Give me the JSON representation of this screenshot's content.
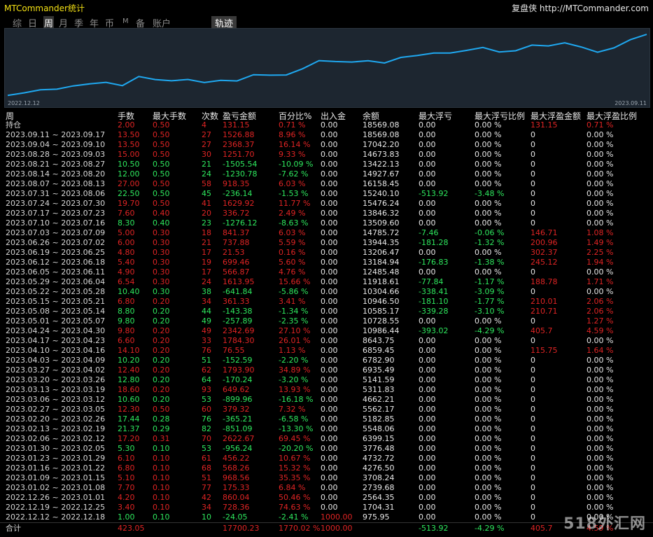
{
  "header": {
    "app_title": "MTCommander统计",
    "brand_text": "复盘侠 http://MTCommander.com"
  },
  "tabs": [
    {
      "label": "综",
      "active": false,
      "small": false
    },
    {
      "label": "日",
      "active": false,
      "small": false
    },
    {
      "label": "周",
      "active": true,
      "small": false
    },
    {
      "label": "月",
      "active": false,
      "small": false
    },
    {
      "label": "季",
      "active": false,
      "small": false
    },
    {
      "label": "年",
      "active": false,
      "small": false
    },
    {
      "label": "币",
      "active": false,
      "small": false
    },
    {
      "label": "M",
      "active": false,
      "small": true
    },
    {
      "label": "备",
      "active": false,
      "small": false
    },
    {
      "label": "账户",
      "active": false,
      "small": false
    }
  ],
  "track_tab": "轨迹",
  "chart_data": {
    "type": "line",
    "x_start": "2022.12.12",
    "x_end": "2023.09.11",
    "series_color": "#1fa8f0",
    "values": [
      975.95,
      1704.31,
      2564.35,
      2739.68,
      3708.24,
      4276.5,
      4732.72,
      3776.48,
      6399.15,
      5548.06,
      5182.85,
      5562.17,
      4662.21,
      5311.83,
      5141.59,
      6935.49,
      6782.9,
      6859.45,
      8643.75,
      10986.44,
      10728.55,
      10585.17,
      10946.5,
      10304.66,
      11918.61,
      12485.48,
      13184.94,
      13206.47,
      13944.35,
      14785.72,
      13509.6,
      13846.32,
      15476.24,
      15240.1,
      16158.45,
      14927.67,
      13422.13,
      14673.83,
      17042.2,
      18569.08
    ]
  },
  "columns": [
    "周",
    "手数",
    "最大手数",
    "次数",
    "盈亏金额",
    "百分比%",
    "出入金",
    "余额",
    "最大浮亏",
    "最大浮亏比例",
    "最大浮盈金额",
    "最大浮盈比例"
  ],
  "rows": [
    {
      "label": "持仓",
      "lots": "2.00",
      "maxlots": "0.50",
      "count": "4",
      "pnl": "131.15",
      "pct": "0.71 %",
      "io": "0.00",
      "balance": "18569.08",
      "maxdd": "0.00",
      "ddpct": "0.00 %",
      "maxfp": "131.15",
      "fppct": "0.71 %",
      "sign": "red",
      "fpcolor": "red"
    },
    {
      "label": "2023.09.11 ~ 2023.09.17",
      "lots": "13.50",
      "maxlots": "0.50",
      "count": "27",
      "pnl": "1526.88",
      "pct": "8.96 %",
      "io": "0.00",
      "balance": "18569.08",
      "maxdd": "0.00",
      "ddpct": "0.00 %",
      "maxfp": "0",
      "fppct": "0.00 %",
      "sign": "red",
      "fpcolor": "white"
    },
    {
      "label": "2023.09.04 ~ 2023.09.10",
      "lots": "13.50",
      "maxlots": "0.50",
      "count": "27",
      "pnl": "2368.37",
      "pct": "16.14 %",
      "io": "0.00",
      "balance": "17042.20",
      "maxdd": "0.00",
      "ddpct": "0.00 %",
      "maxfp": "0",
      "fppct": "0.00 %",
      "sign": "red",
      "fpcolor": "white"
    },
    {
      "label": "2023.08.28 ~ 2023.09.03",
      "lots": "15.00",
      "maxlots": "0.50",
      "count": "30",
      "pnl": "1251.70",
      "pct": "9.33 %",
      "io": "0.00",
      "balance": "14673.83",
      "maxdd": "0.00",
      "ddpct": "0.00 %",
      "maxfp": "0",
      "fppct": "0.00 %",
      "sign": "red",
      "fpcolor": "white"
    },
    {
      "label": "2023.08.21 ~ 2023.08.27",
      "lots": "10.50",
      "maxlots": "0.50",
      "count": "21",
      "pnl": "-1505.54",
      "pct": "-10.09 %",
      "io": "0.00",
      "balance": "13422.13",
      "maxdd": "0.00",
      "ddpct": "0.00 %",
      "maxfp": "0",
      "fppct": "0.00 %",
      "sign": "green",
      "fpcolor": "white"
    },
    {
      "label": "2023.08.14 ~ 2023.08.20",
      "lots": "12.00",
      "maxlots": "0.50",
      "count": "24",
      "pnl": "-1230.78",
      "pct": "-7.62 %",
      "io": "0.00",
      "balance": "14927.67",
      "maxdd": "0.00",
      "ddpct": "0.00 %",
      "maxfp": "0",
      "fppct": "0.00 %",
      "sign": "green",
      "fpcolor": "white"
    },
    {
      "label": "2023.08.07 ~ 2023.08.13",
      "lots": "27.00",
      "maxlots": "0.50",
      "count": "58",
      "pnl": "918.35",
      "pct": "6.03 %",
      "io": "0.00",
      "balance": "16158.45",
      "maxdd": "0.00",
      "ddpct": "0.00 %",
      "maxfp": "0",
      "fppct": "0.00 %",
      "sign": "red",
      "fpcolor": "white"
    },
    {
      "label": "2023.07.31 ~ 2023.08.06",
      "lots": "22.50",
      "maxlots": "0.50",
      "count": "45",
      "pnl": "-236.14",
      "pct": "-1.53 %",
      "io": "0.00",
      "balance": "15240.10",
      "maxdd": "-513.92",
      "ddpct": "-3.48 %",
      "maxfp": "0",
      "fppct": "0.00 %",
      "sign": "green",
      "fpcolor": "white"
    },
    {
      "label": "2023.07.24 ~ 2023.07.30",
      "lots": "19.70",
      "maxlots": "0.50",
      "count": "41",
      "pnl": "1629.92",
      "pct": "11.77 %",
      "io": "0.00",
      "balance": "15476.24",
      "maxdd": "0.00",
      "ddpct": "0.00 %",
      "maxfp": "0",
      "fppct": "0.00 %",
      "sign": "red",
      "fpcolor": "white"
    },
    {
      "label": "2023.07.17 ~ 2023.07.23",
      "lots": "7.60",
      "maxlots": "0.40",
      "count": "20",
      "pnl": "336.72",
      "pct": "2.49 %",
      "io": "0.00",
      "balance": "13846.32",
      "maxdd": "0.00",
      "ddpct": "0.00 %",
      "maxfp": "0",
      "fppct": "0.00 %",
      "sign": "red",
      "fpcolor": "white"
    },
    {
      "label": "2023.07.10 ~ 2023.07.16",
      "lots": "8.30",
      "maxlots": "0.40",
      "count": "23",
      "pnl": "-1276.12",
      "pct": "-8.63 %",
      "io": "0.00",
      "balance": "13509.60",
      "maxdd": "0.00",
      "ddpct": "0.00 %",
      "maxfp": "0",
      "fppct": "0.00 %",
      "sign": "green",
      "fpcolor": "white"
    },
    {
      "label": "2023.07.03 ~ 2023.07.09",
      "lots": "5.00",
      "maxlots": "0.30",
      "count": "18",
      "pnl": "841.37",
      "pct": "6.03 %",
      "io": "0.00",
      "balance": "14785.72",
      "maxdd": "-7.46",
      "ddpct": "-0.06 %",
      "maxfp": "146.71",
      "fppct": "1.08 %",
      "sign": "red",
      "fpcolor": "red"
    },
    {
      "label": "2023.06.26 ~ 2023.07.02",
      "lots": "6.00",
      "maxlots": "0.30",
      "count": "21",
      "pnl": "737.88",
      "pct": "5.59 %",
      "io": "0.00",
      "balance": "13944.35",
      "maxdd": "-181.28",
      "ddpct": "-1.32 %",
      "maxfp": "200.96",
      "fppct": "1.49 %",
      "sign": "red",
      "fpcolor": "red"
    },
    {
      "label": "2023.06.19 ~ 2023.06.25",
      "lots": "4.80",
      "maxlots": "0.30",
      "count": "17",
      "pnl": "21.53",
      "pct": "0.16 %",
      "io": "0.00",
      "balance": "13206.47",
      "maxdd": "0.00",
      "ddpct": "0.00 %",
      "maxfp": "302.37",
      "fppct": "2.25 %",
      "sign": "red",
      "fpcolor": "red"
    },
    {
      "label": "2023.06.12 ~ 2023.06.18",
      "lots": "5.40",
      "maxlots": "0.30",
      "count": "19",
      "pnl": "699.46",
      "pct": "5.60 %",
      "io": "0.00",
      "balance": "13184.94",
      "maxdd": "-176.83",
      "ddpct": "-1.38 %",
      "maxfp": "245.12",
      "fppct": "1.94 %",
      "sign": "red",
      "fpcolor": "red"
    },
    {
      "label": "2023.06.05 ~ 2023.06.11",
      "lots": "4.90",
      "maxlots": "0.30",
      "count": "17",
      "pnl": "566.87",
      "pct": "4.76 %",
      "io": "0.00",
      "balance": "12485.48",
      "maxdd": "0.00",
      "ddpct": "0.00 %",
      "maxfp": "0",
      "fppct": "0.00 %",
      "sign": "red",
      "fpcolor": "white"
    },
    {
      "label": "2023.05.29 ~ 2023.06.04",
      "lots": "6.54",
      "maxlots": "0.30",
      "count": "24",
      "pnl": "1613.95",
      "pct": "15.66 %",
      "io": "0.00",
      "balance": "11918.61",
      "maxdd": "-77.84",
      "ddpct": "-1.17 %",
      "maxfp": "188.78",
      "fppct": "1.71 %",
      "sign": "red",
      "fpcolor": "red"
    },
    {
      "label": "2023.05.22 ~ 2023.05.28",
      "lots": "10.40",
      "maxlots": "0.30",
      "count": "38",
      "pnl": "-641.84",
      "pct": "-5.86 %",
      "io": "0.00",
      "balance": "10304.66",
      "maxdd": "-338.41",
      "ddpct": "-3.09 %",
      "maxfp": "0",
      "fppct": "0.00 %",
      "sign": "green",
      "fpcolor": "white"
    },
    {
      "label": "2023.05.15 ~ 2023.05.21",
      "lots": "6.80",
      "maxlots": "0.20",
      "count": "34",
      "pnl": "361.33",
      "pct": "3.41 %",
      "io": "0.00",
      "balance": "10946.50",
      "maxdd": "-181.10",
      "ddpct": "-1.77 %",
      "maxfp": "210.01",
      "fppct": "2.06 %",
      "sign": "red",
      "fpcolor": "red"
    },
    {
      "label": "2023.05.08 ~ 2023.05.14",
      "lots": "8.80",
      "maxlots": "0.20",
      "count": "44",
      "pnl": "-143.38",
      "pct": "-1.34 %",
      "io": "0.00",
      "balance": "10585.17",
      "maxdd": "-339.28",
      "ddpct": "-3.10 %",
      "maxfp": "210.71",
      "fppct": "2.06 %",
      "sign": "green",
      "fpcolor": "red"
    },
    {
      "label": "2023.05.01 ~ 2023.05.07",
      "lots": "9.80",
      "maxlots": "0.20",
      "count": "49",
      "pnl": "-257.89",
      "pct": "-2.35 %",
      "io": "0.00",
      "balance": "10728.55",
      "maxdd": "0.00",
      "ddpct": "0.00 %",
      "maxfp": "0",
      "fppct": "1.27 %",
      "sign": "green",
      "fpcolor": "redpct"
    },
    {
      "label": "2023.04.24 ~ 2023.04.30",
      "lots": "9.80",
      "maxlots": "0.20",
      "count": "49",
      "pnl": "2342.69",
      "pct": "27.10 %",
      "io": "0.00",
      "balance": "10986.44",
      "maxdd": "-393.02",
      "ddpct": "-4.29 %",
      "maxfp": "405.7",
      "fppct": "4.59 %",
      "sign": "red",
      "fpcolor": "red"
    },
    {
      "label": "2023.04.17 ~ 2023.04.23",
      "lots": "6.60",
      "maxlots": "0.20",
      "count": "33",
      "pnl": "1784.30",
      "pct": "26.01 %",
      "io": "0.00",
      "balance": "8643.75",
      "maxdd": "0.00",
      "ddpct": "0.00 %",
      "maxfp": "0",
      "fppct": "0.00 %",
      "sign": "red",
      "fpcolor": "white"
    },
    {
      "label": "2023.04.10 ~ 2023.04.16",
      "lots": "14.10",
      "maxlots": "0.20",
      "count": "76",
      "pnl": "76.55",
      "pct": "1.13 %",
      "io": "0.00",
      "balance": "6859.45",
      "maxdd": "0.00",
      "ddpct": "0.00 %",
      "maxfp": "115.75",
      "fppct": "1.64 %",
      "sign": "red",
      "fpcolor": "red"
    },
    {
      "label": "2023.04.03 ~ 2023.04.09",
      "lots": "10.20",
      "maxlots": "0.20",
      "count": "51",
      "pnl": "-152.59",
      "pct": "-2.20 %",
      "io": "0.00",
      "balance": "6782.90",
      "maxdd": "0.00",
      "ddpct": "0.00 %",
      "maxfp": "0",
      "fppct": "0.00 %",
      "sign": "green",
      "fpcolor": "white"
    },
    {
      "label": "2023.03.27 ~ 2023.04.02",
      "lots": "12.40",
      "maxlots": "0.20",
      "count": "62",
      "pnl": "1793.90",
      "pct": "34.89 %",
      "io": "0.00",
      "balance": "6935.49",
      "maxdd": "0.00",
      "ddpct": "0.00 %",
      "maxfp": "0",
      "fppct": "0.00 %",
      "sign": "red",
      "fpcolor": "white"
    },
    {
      "label": "2023.03.20 ~ 2023.03.26",
      "lots": "12.80",
      "maxlots": "0.20",
      "count": "64",
      "pnl": "-170.24",
      "pct": "-3.20 %",
      "io": "0.00",
      "balance": "5141.59",
      "maxdd": "0.00",
      "ddpct": "0.00 %",
      "maxfp": "0",
      "fppct": "0.00 %",
      "sign": "green",
      "fpcolor": "white"
    },
    {
      "label": "2023.03.13 ~ 2023.03.19",
      "lots": "18.60",
      "maxlots": "0.20",
      "count": "93",
      "pnl": "649.62",
      "pct": "13.93 %",
      "io": "0.00",
      "balance": "5311.83",
      "maxdd": "0.00",
      "ddpct": "0.00 %",
      "maxfp": "0",
      "fppct": "0.00 %",
      "sign": "red",
      "fpcolor": "white"
    },
    {
      "label": "2023.03.06 ~ 2023.03.12",
      "lots": "10.60",
      "maxlots": "0.20",
      "count": "53",
      "pnl": "-899.96",
      "pct": "-16.18 %",
      "io": "0.00",
      "balance": "4662.21",
      "maxdd": "0.00",
      "ddpct": "0.00 %",
      "maxfp": "0",
      "fppct": "0.00 %",
      "sign": "green",
      "fpcolor": "white"
    },
    {
      "label": "2023.02.27 ~ 2023.03.05",
      "lots": "12.30",
      "maxlots": "0.50",
      "count": "60",
      "pnl": "379.32",
      "pct": "7.32 %",
      "io": "0.00",
      "balance": "5562.17",
      "maxdd": "0.00",
      "ddpct": "0.00 %",
      "maxfp": "0",
      "fppct": "0.00 %",
      "sign": "red",
      "fpcolor": "white"
    },
    {
      "label": "2023.02.20 ~ 2023.02.26",
      "lots": "17.44",
      "maxlots": "0.28",
      "count": "76",
      "pnl": "-365.21",
      "pct": "-6.58 %",
      "io": "0.00",
      "balance": "5182.85",
      "maxdd": "0.00",
      "ddpct": "0.00 %",
      "maxfp": "0",
      "fppct": "0.00 %",
      "sign": "green",
      "fpcolor": "white"
    },
    {
      "label": "2023.02.13 ~ 2023.02.19",
      "lots": "21.37",
      "maxlots": "0.29",
      "count": "82",
      "pnl": "-851.09",
      "pct": "-13.30 %",
      "io": "0.00",
      "balance": "5548.06",
      "maxdd": "0.00",
      "ddpct": "0.00 %",
      "maxfp": "0",
      "fppct": "0.00 %",
      "sign": "green",
      "fpcolor": "white"
    },
    {
      "label": "2023.02.06 ~ 2023.02.12",
      "lots": "17.20",
      "maxlots": "0.31",
      "count": "70",
      "pnl": "2622.67",
      "pct": "69.45 %",
      "io": "0.00",
      "balance": "6399.15",
      "maxdd": "0.00",
      "ddpct": "0.00 %",
      "maxfp": "0",
      "fppct": "0.00 %",
      "sign": "red",
      "fpcolor": "white"
    },
    {
      "label": "2023.01.30 ~ 2023.02.05",
      "lots": "5.30",
      "maxlots": "0.10",
      "count": "53",
      "pnl": "-956.24",
      "pct": "-20.20 %",
      "io": "0.00",
      "balance": "3776.48",
      "maxdd": "0.00",
      "ddpct": "0.00 %",
      "maxfp": "0",
      "fppct": "0.00 %",
      "sign": "green",
      "fpcolor": "white"
    },
    {
      "label": "2023.01.23 ~ 2023.01.29",
      "lots": "6.10",
      "maxlots": "0.10",
      "count": "61",
      "pnl": "456.22",
      "pct": "10.67 %",
      "io": "0.00",
      "balance": "4732.72",
      "maxdd": "0.00",
      "ddpct": "0.00 %",
      "maxfp": "0",
      "fppct": "0.00 %",
      "sign": "red",
      "fpcolor": "white"
    },
    {
      "label": "2023.01.16 ~ 2023.01.22",
      "lots": "6.80",
      "maxlots": "0.10",
      "count": "68",
      "pnl": "568.26",
      "pct": "15.32 %",
      "io": "0.00",
      "balance": "4276.50",
      "maxdd": "0.00",
      "ddpct": "0.00 %",
      "maxfp": "0",
      "fppct": "0.00 %",
      "sign": "red",
      "fpcolor": "white"
    },
    {
      "label": "2023.01.09 ~ 2023.01.15",
      "lots": "5.10",
      "maxlots": "0.10",
      "count": "51",
      "pnl": "968.56",
      "pct": "35.35 %",
      "io": "0.00",
      "balance": "3708.24",
      "maxdd": "0.00",
      "ddpct": "0.00 %",
      "maxfp": "0",
      "fppct": "0.00 %",
      "sign": "red",
      "fpcolor": "white"
    },
    {
      "label": "2023.01.02 ~ 2023.01.08",
      "lots": "7.70",
      "maxlots": "0.10",
      "count": "77",
      "pnl": "175.33",
      "pct": "6.84 %",
      "io": "0.00",
      "balance": "2739.68",
      "maxdd": "0.00",
      "ddpct": "0.00 %",
      "maxfp": "0",
      "fppct": "0.00 %",
      "sign": "red",
      "fpcolor": "white"
    },
    {
      "label": "2022.12.26 ~ 2023.01.01",
      "lots": "4.20",
      "maxlots": "0.10",
      "count": "42",
      "pnl": "860.04",
      "pct": "50.46 %",
      "io": "0.00",
      "balance": "2564.35",
      "maxdd": "0.00",
      "ddpct": "0.00 %",
      "maxfp": "0",
      "fppct": "0.00 %",
      "sign": "red",
      "fpcolor": "white"
    },
    {
      "label": "2022.12.19 ~ 2022.12.25",
      "lots": "3.40",
      "maxlots": "0.10",
      "count": "34",
      "pnl": "728.36",
      "pct": "74.63 %",
      "io": "0.00",
      "balance": "1704.31",
      "maxdd": "0.00",
      "ddpct": "0.00 %",
      "maxfp": "0",
      "fppct": "0.00 %",
      "sign": "red",
      "fpcolor": "white"
    },
    {
      "label": "2022.12.12 ~ 2022.12.18",
      "lots": "1.00",
      "maxlots": "0.10",
      "count": "10",
      "pnl": "-24.05",
      "pct": "-2.41 %",
      "io": "1000.00",
      "balance": "975.95",
      "maxdd": "0.00",
      "ddpct": "0.00 %",
      "maxfp": "0",
      "fppct": "0.00 %",
      "sign": "green",
      "fpcolor": "white",
      "ioRed": true
    }
  ],
  "total": {
    "label": "合计",
    "lots": "423.05",
    "pnl": "17700.23",
    "pct": "1770.02 %",
    "io": "1000.00",
    "maxdd": "-513.92",
    "ddpct": "-4.29 %",
    "maxfp": "405.7",
    "fppct": "4.59 %"
  },
  "watermark": "518外汇网"
}
